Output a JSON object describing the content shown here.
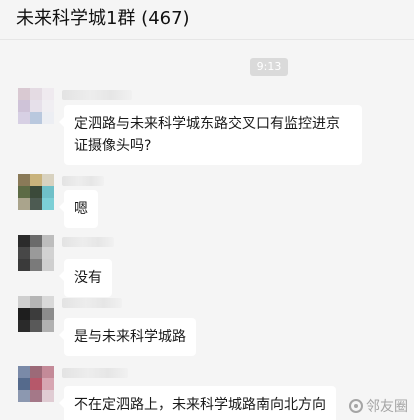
{
  "header": {
    "title": "未来科学城1群 (467)"
  },
  "time_divider": "9:13",
  "messages": [
    {
      "text": "定泗路与未来科学城东路交叉口有监控进京证摄像头吗?",
      "avatar_icon": "blurred-user-avatar"
    },
    {
      "text": "嗯",
      "avatar_icon": "blurred-user-avatar"
    },
    {
      "text": "没有",
      "avatar_icon": "blurred-user-avatar"
    },
    {
      "text": "是与未来科学城路",
      "avatar_icon": "blurred-user-avatar"
    },
    {
      "text": "不在定泗路上，未来科学城路南向北方向",
      "avatar_icon": "blurred-user-avatar"
    }
  ],
  "watermark": {
    "text": "邻友圈",
    "icon": "watermark-logo-icon"
  },
  "colors": {
    "background": "#f5f5f5",
    "bubble": "#ffffff",
    "time_chip": "#dadada"
  }
}
